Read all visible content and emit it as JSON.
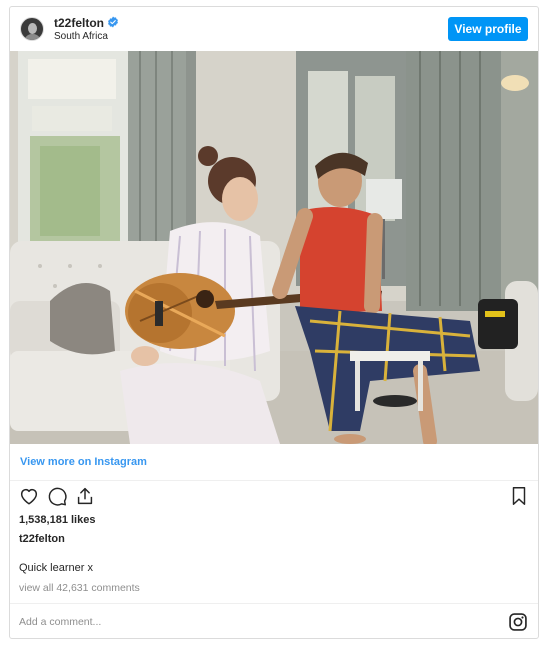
{
  "header": {
    "username": "t22felton",
    "location": "South Africa",
    "verified_icon": "verified-badge-icon",
    "view_profile_label": "View profile"
  },
  "post": {
    "image_icon": "photo",
    "view_more_label": "View more on Instagram",
    "likes_text": "1,538,181 likes",
    "owner": "t22felton",
    "caption": "Quick learner x",
    "comments_text": "view all 42,631 comments"
  },
  "actions": {
    "icons": [
      "heart-icon",
      "comment-icon",
      "share-icon",
      "bookmark-icon"
    ]
  },
  "comment": {
    "placeholder": "Add a comment..."
  },
  "colors": {
    "accent": "#0095f6",
    "link": "#3897f0",
    "muted": "#8e8e8e",
    "border": "#dbdbdb"
  }
}
